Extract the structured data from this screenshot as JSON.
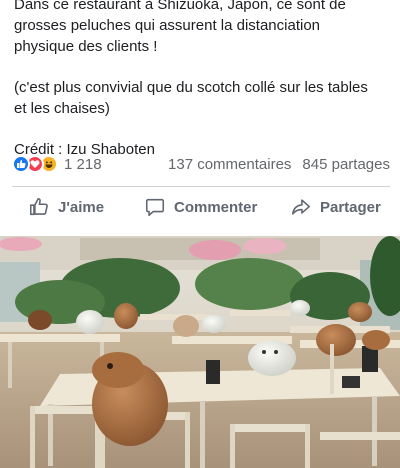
{
  "post": {
    "line1": "Dans ce restaurant à Shizuoka, Japon, ce sont de",
    "line2": "grosses peluches qui assurent la distanciation",
    "line3": "physique des clients !",
    "line4": "(c'est plus convivial que du scotch collé sur les tables",
    "line5": "et les chaises)",
    "credit": "Crédit : Izu Shaboten"
  },
  "stats": {
    "reaction_icons": [
      "like-icon",
      "love-icon",
      "haha-icon"
    ],
    "reaction_count": "1 218",
    "comments": "137 commentaires",
    "shares": "845 partages"
  },
  "actions": {
    "like_label": "J'aime",
    "comment_label": "Commenter",
    "share_label": "Partager"
  },
  "colors": {
    "like": "#1877f2",
    "love": "#f33e58",
    "haha": "#f7b125",
    "muted_text": "#65676b"
  }
}
